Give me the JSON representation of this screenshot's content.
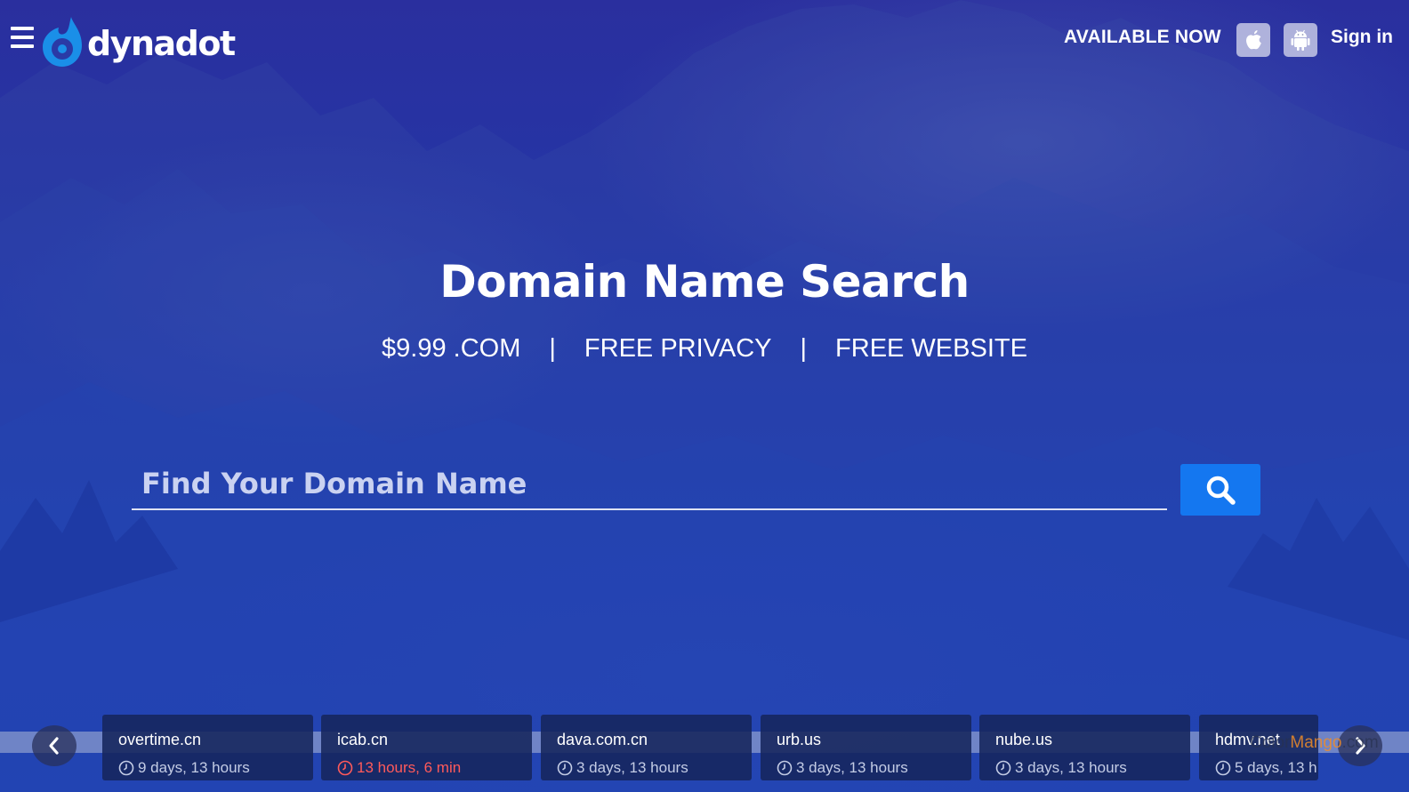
{
  "header": {
    "menu_icon": "hamburger-menu-icon",
    "logo_text": "dynadot",
    "available_label": "AVAILABLE NOW",
    "ios_icon": "apple-icon",
    "android_icon": "android-icon",
    "signin_label": "Sign in"
  },
  "hero": {
    "title": "Domain Name Search",
    "features": [
      "$9.99 .COM",
      "FREE PRIVACY",
      "FREE WEBSITE"
    ],
    "separator": "|"
  },
  "search": {
    "placeholder": "Find Your Domain Name",
    "value": "",
    "button_icon": "search-icon"
  },
  "auctions": {
    "prev_icon": "chevron-left-icon",
    "next_icon": "chevron-right-icon",
    "items": [
      {
        "domain": "overtime.cn",
        "time_left": "9 days, 13 hours",
        "urgent": false
      },
      {
        "domain": "icab.cn",
        "time_left": "13 hours, 6 min",
        "urgent": true
      },
      {
        "domain": "dava.com.cn",
        "time_left": "3 days, 13 hours",
        "urgent": false
      },
      {
        "domain": "urb.us",
        "time_left": "3 days, 13 hours",
        "urgent": false
      },
      {
        "domain": "nube.us",
        "time_left": "3 days, 13 hours",
        "urgent": false
      },
      {
        "domain": "hdmv.net",
        "time_left": "5 days, 13 h",
        "urgent": false
      }
    ]
  },
  "watermark": {
    "part1": "Color",
    "part2": "Mango",
    "part3": ".com"
  },
  "colors": {
    "background": "#1f3aae",
    "search_button": "#1477f0",
    "urgent_text": "#ff5a5a",
    "text": "#ffffff"
  }
}
